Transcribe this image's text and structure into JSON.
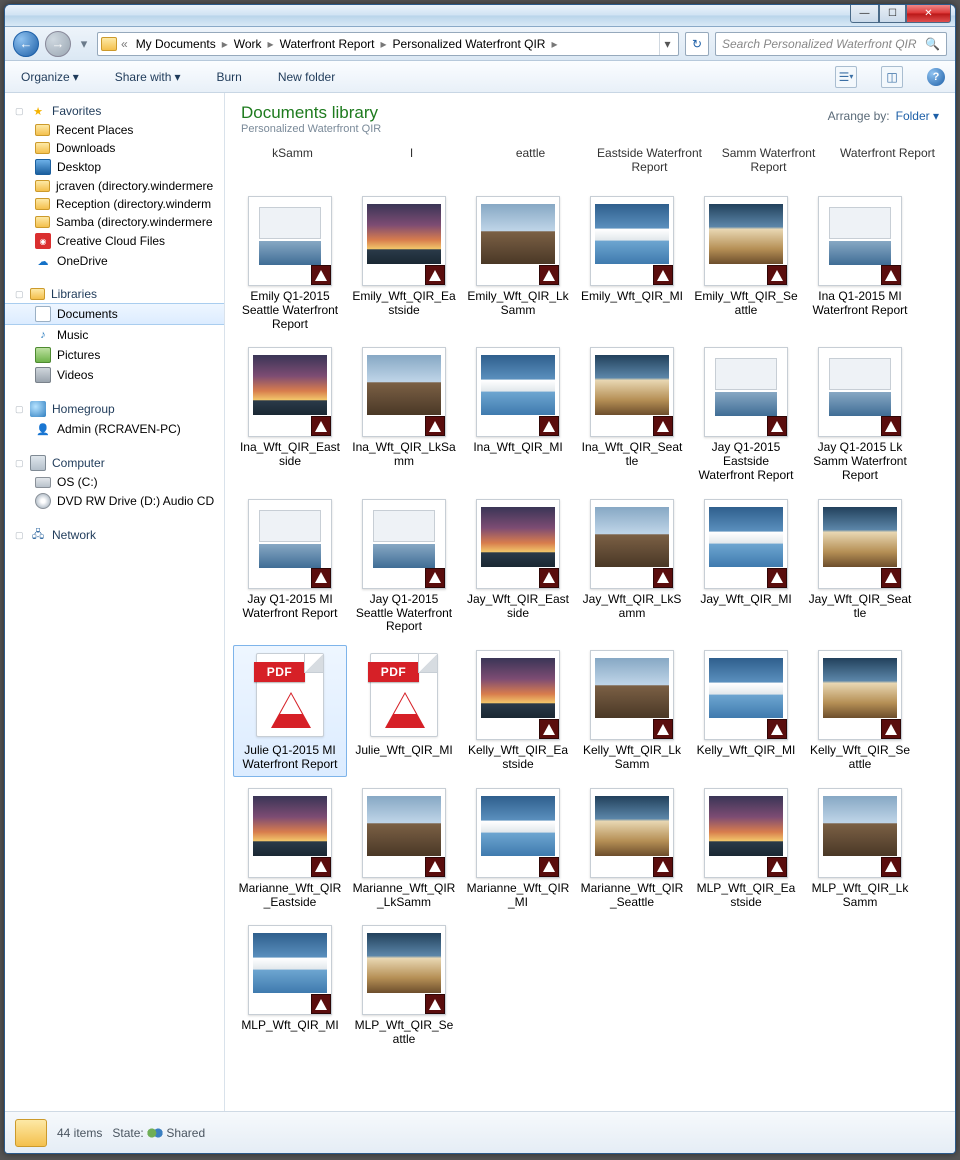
{
  "breadcrumbs": {
    "prefix": "«",
    "items": [
      "My Documents",
      "Work",
      "Waterfront Report",
      "Personalized Waterfront QIR"
    ]
  },
  "search": {
    "placeholder": "Search Personalized Waterfront QIR"
  },
  "toolbar": {
    "organize": "Organize",
    "share": "Share with",
    "burn": "Burn",
    "newfolder": "New folder"
  },
  "nav": {
    "favorites": {
      "label": "Favorites",
      "items": [
        {
          "label": "Recent Places",
          "icon": "folder"
        },
        {
          "label": "Downloads",
          "icon": "folder"
        },
        {
          "label": "Desktop",
          "icon": "monitor"
        },
        {
          "label": "jcraven (directory.windermere",
          "icon": "netfolder"
        },
        {
          "label": "Reception (directory.winderm",
          "icon": "netfolder"
        },
        {
          "label": "Samba (directory.windermere",
          "icon": "netfolder"
        },
        {
          "label": "Creative Cloud Files",
          "icon": "cc"
        },
        {
          "label": "OneDrive",
          "icon": "onedrive"
        }
      ]
    },
    "libraries": {
      "label": "Libraries",
      "items": [
        {
          "label": "Documents",
          "icon": "doc",
          "selected": true
        },
        {
          "label": "Music",
          "icon": "music"
        },
        {
          "label": "Pictures",
          "icon": "pic"
        },
        {
          "label": "Videos",
          "icon": "vid"
        }
      ]
    },
    "homegroup": {
      "label": "Homegroup",
      "items": [
        {
          "label": "Admin (RCRAVEN-PC)",
          "icon": "user"
        }
      ]
    },
    "computer": {
      "label": "Computer",
      "items": [
        {
          "label": "OS (C:)",
          "icon": "drive"
        },
        {
          "label": "DVD RW Drive (D:) Audio CD",
          "icon": "disc"
        }
      ]
    },
    "network": {
      "label": "Network"
    }
  },
  "library": {
    "title": "Documents library",
    "subtitle": "Personalized Waterfront QIR",
    "arrange_by_label": "Arrange by:",
    "arrange_by_value": "Folder"
  },
  "header_labels": [
    "kSamm",
    "I",
    "eattle",
    "Eastside Waterfront Report",
    "Samm Waterfront Report",
    "Waterfront Report"
  ],
  "files": [
    {
      "name": "Emily Q1-2015 Seattle Waterfront Report",
      "thumb": "doc"
    },
    {
      "name": "Emily_Wft_QIR_Eastside",
      "thumb": "sunset"
    },
    {
      "name": "Emily_Wft_QIR_LkSamm",
      "thumb": "house"
    },
    {
      "name": "Emily_Wft_QIR_MI",
      "thumb": "pool"
    },
    {
      "name": "Emily_Wft_QIR_Seattle",
      "thumb": "interior"
    },
    {
      "name": "Ina Q1-2015 MI Waterfront Report",
      "thumb": "doc"
    },
    {
      "name": "Ina_Wft_QIR_Eastside",
      "thumb": "sunset"
    },
    {
      "name": "Ina_Wft_QIR_LkSamm",
      "thumb": "house"
    },
    {
      "name": "Ina_Wft_QIR_MI",
      "thumb": "pool"
    },
    {
      "name": "Ina_Wft_QIR_Seattle",
      "thumb": "interior"
    },
    {
      "name": "Jay Q1-2015 Eastside Waterfront Report",
      "thumb": "doc"
    },
    {
      "name": "Jay Q1-2015 Lk Samm Waterfront Report",
      "thumb": "doc"
    },
    {
      "name": "Jay Q1-2015 MI Waterfront Report",
      "thumb": "doc"
    },
    {
      "name": "Jay Q1-2015 Seattle Waterfront Report",
      "thumb": "doc"
    },
    {
      "name": "Jay_Wft_QIR_Eastside",
      "thumb": "sunset"
    },
    {
      "name": "Jay_Wft_QIR_LkSamm",
      "thumb": "house"
    },
    {
      "name": "Jay_Wft_QIR_MI",
      "thumb": "pool"
    },
    {
      "name": "Jay_Wft_QIR_Seattle",
      "thumb": "interior"
    },
    {
      "name": "Julie Q1-2015 MI Waterfront Report",
      "thumb": "pdf",
      "selected": true
    },
    {
      "name": "Julie_Wft_QIR_MI",
      "thumb": "pdf"
    },
    {
      "name": "Kelly_Wft_QIR_Eastside",
      "thumb": "sunset"
    },
    {
      "name": "Kelly_Wft_QIR_LkSamm",
      "thumb": "house"
    },
    {
      "name": "Kelly_Wft_QIR_MI",
      "thumb": "pool"
    },
    {
      "name": "Kelly_Wft_QIR_Seattle",
      "thumb": "interior"
    },
    {
      "name": "Marianne_Wft_QIR_Eastside",
      "thumb": "sunset"
    },
    {
      "name": "Marianne_Wft_QIR_LkSamm",
      "thumb": "house"
    },
    {
      "name": "Marianne_Wft_QIR_MI",
      "thumb": "pool"
    },
    {
      "name": "Marianne_Wft_QIR_Seattle",
      "thumb": "interior"
    },
    {
      "name": "MLP_Wft_QIR_Eastside",
      "thumb": "sunset"
    },
    {
      "name": "MLP_Wft_QIR_LkSamm",
      "thumb": "house"
    },
    {
      "name": "MLP_Wft_QIR_MI",
      "thumb": "pool"
    },
    {
      "name": "MLP_Wft_QIR_Seattle",
      "thumb": "interior"
    }
  ],
  "status": {
    "count": "44 items",
    "state_label": "State:",
    "state_value": "Shared"
  },
  "pdf_band": "PDF"
}
